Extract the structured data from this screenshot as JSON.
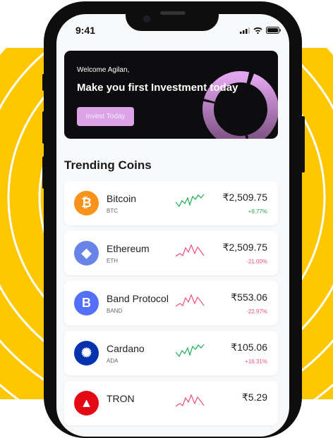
{
  "status_bar": {
    "time": "9:41"
  },
  "banner": {
    "welcome": "Welcome Agilan,",
    "headline": "Make you first Investment today",
    "button": "Invest Today"
  },
  "section_title": "Trending Coins",
  "colors": {
    "background": "#FFC700",
    "accent": "#DCA3E8",
    "positive": "#1FAA55",
    "negative": "#F0507A"
  },
  "coins": [
    {
      "name": "Bitcoin",
      "symbol": "BTC",
      "price": "₹2,509.75",
      "change": "+9.77%",
      "trend": "up",
      "icon": "bitcoin-icon",
      "color": "#F7931A"
    },
    {
      "name": "Ethereum",
      "symbol": "ETH",
      "price": "₹2,509.75",
      "change": "-21.00%",
      "trend": "down",
      "icon": "ethereum-icon",
      "color": "#6A83E8"
    },
    {
      "name": "Band Protocol",
      "symbol": "BAND",
      "price": "₹553.06",
      "change": "-22.97%",
      "trend": "down",
      "icon": "band-protocol-icon",
      "color": "#5470F8"
    },
    {
      "name": "Cardano",
      "symbol": "ADA",
      "price": "₹105.06",
      "change": "+16.31%",
      "trend": "up",
      "icon": "cardano-icon",
      "color": "#0433AD"
    },
    {
      "name": "TRON",
      "symbol": "",
      "price": "₹5.29",
      "change": "",
      "trend": "down",
      "icon": "tron-icon",
      "color": "#E50914"
    }
  ]
}
